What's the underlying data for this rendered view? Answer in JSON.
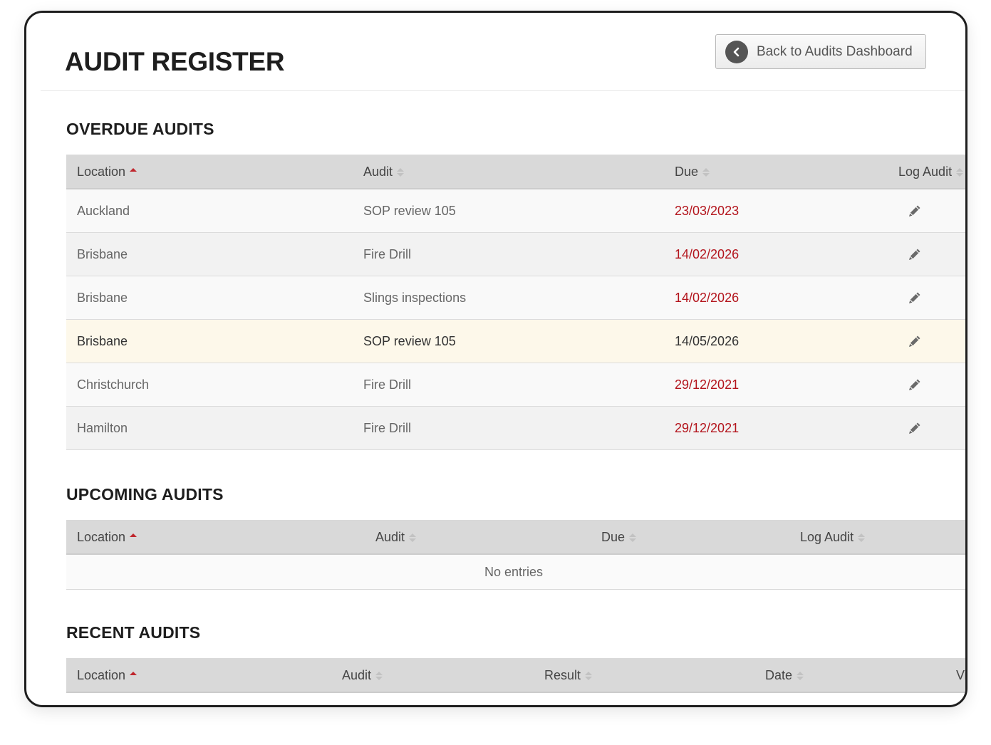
{
  "header": {
    "title": "AUDIT REGISTER",
    "back_button_label": "Back to Audits Dashboard"
  },
  "overdue": {
    "title": "OVERDUE AUDITS",
    "columns": [
      "Location",
      "Audit",
      "Due",
      "Log Audit"
    ],
    "rows": [
      {
        "location": "Auckland",
        "audit": "SOP review 105",
        "due": "23/03/2023"
      },
      {
        "location": "Brisbane",
        "audit": "Fire Drill",
        "due": "14/02/2026"
      },
      {
        "location": "Brisbane",
        "audit": "Slings inspections",
        "due": "14/02/2026"
      },
      {
        "location": "Brisbane",
        "audit": "SOP review 105",
        "due": "14/05/2026"
      },
      {
        "location": "Christchurch",
        "audit": "Fire Drill",
        "due": "29/12/2021"
      },
      {
        "location": "Hamilton",
        "audit": "Fire Drill",
        "due": "29/12/2021"
      }
    ]
  },
  "upcoming": {
    "title": "UPCOMING AUDITS",
    "columns": [
      "Location",
      "Audit",
      "Due",
      "Log Audit"
    ],
    "empty_text": "No entries"
  },
  "recent": {
    "title": "RECENT AUDITS",
    "columns": [
      "Location",
      "Audit",
      "Result",
      "Date",
      "Vi"
    ]
  },
  "icons": {
    "back": "chevron-left-icon",
    "log_audit": "pencil-icon",
    "sort_asc": "sort-asc-icon",
    "sort_both": "sort-both-icon"
  },
  "colors": {
    "due_overdue": "#b3141c",
    "sort_active": "#c0262d",
    "header_bg": "#d9d9d9",
    "row_hover": "#fdf8ea"
  }
}
